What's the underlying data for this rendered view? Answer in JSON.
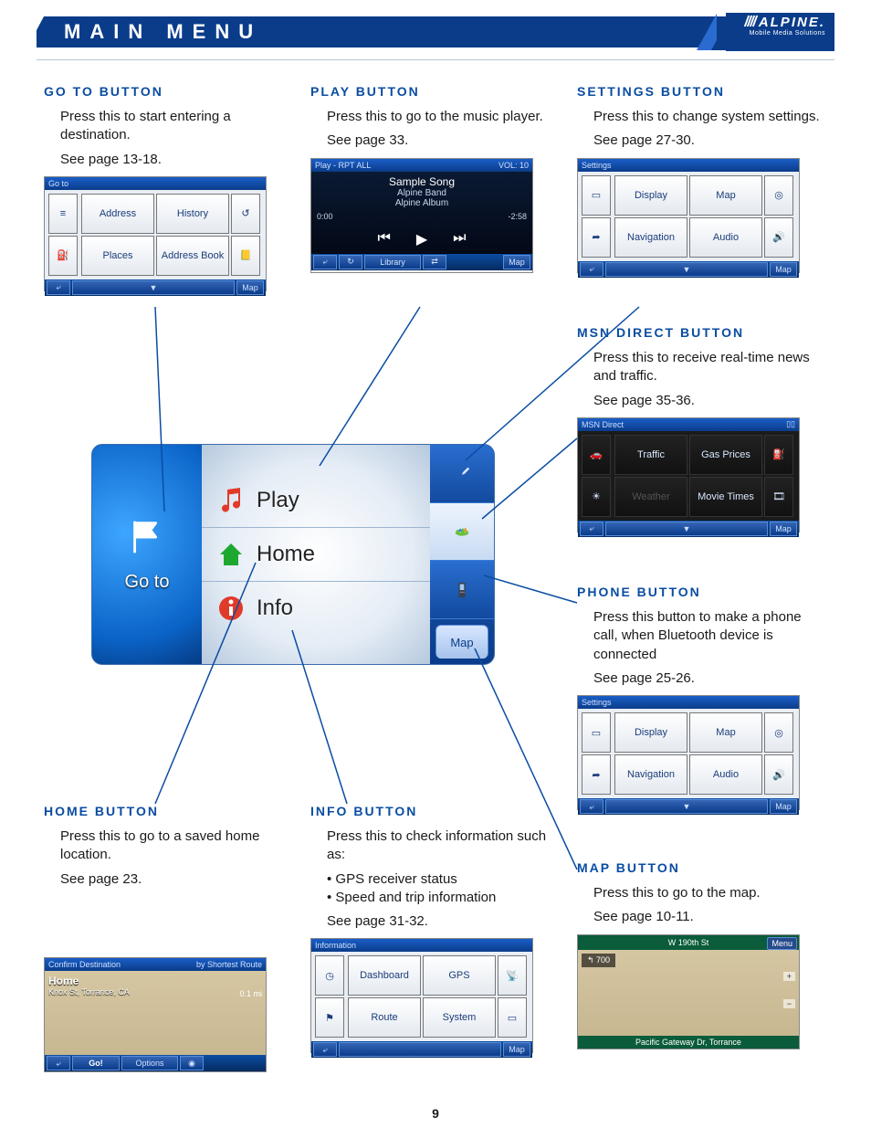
{
  "header": {
    "title": "MAIN MENU",
    "brand": "/ / / / ALPINE",
    "brand_sub": "Mobile Media Solutions"
  },
  "page_number": "9",
  "callouts": {
    "goto": {
      "heading": "GO TO BUTTON",
      "desc": "Press this to start entering a destination.",
      "ref": "See page 13-18."
    },
    "play": {
      "heading": "PLAY BUTTON",
      "desc": "Press this to go to the music player.",
      "ref": "See page 33."
    },
    "settings": {
      "heading": "SETTINGS BUTTON",
      "desc": "Press this to change system settings.",
      "ref": "See page 27-30."
    },
    "msn": {
      "heading": "MSN DIRECT BUTTON",
      "desc": "Press this to receive real-time news and traffic.",
      "ref": "See page 35-36."
    },
    "phone": {
      "heading": "PHONE BUTTON",
      "desc": "Press this button to make a phone call, when Bluetooth device is connected",
      "ref": "See page 25-26."
    },
    "home": {
      "heading": "HOME BUTTON",
      "desc": "Press this to go to a saved home location.",
      "ref": "See page 23."
    },
    "info": {
      "heading": "INFO BUTTON",
      "desc": "Press this to check information such as:",
      "bullets": [
        "GPS receiver status",
        "Speed and trip information"
      ],
      "ref": "See page 31-32."
    },
    "map": {
      "heading": "MAP BUTTON",
      "desc": "Press this to go to the map.",
      "ref": "See page 10-11."
    }
  },
  "mini_screens": {
    "goto": {
      "title": "Go to",
      "cells": [
        "Address",
        "History",
        "Places",
        "Address Book"
      ],
      "map_btn": "Map"
    },
    "play": {
      "title_left": "Play - RPT ALL",
      "title_right": "VOL: 10",
      "song": "Sample Song",
      "artist": "Alpine Band",
      "album": "Alpine Album",
      "t_start": "0:00",
      "t_end": "-2:58",
      "library": "Library",
      "map_btn": "Map"
    },
    "settings": {
      "title": "Settings",
      "cells": [
        "Display",
        "Map",
        "Navigation",
        "Audio"
      ],
      "map_btn": "Map"
    },
    "msn": {
      "title": "MSN Direct",
      "cells": [
        "Traffic",
        "Gas Prices",
        "Weather",
        "Movie Times"
      ],
      "map_btn": "Map"
    },
    "phone": {
      "title": "Settings",
      "cells": [
        "Display",
        "Map",
        "Navigation",
        "Audio"
      ],
      "map_btn": "Map"
    },
    "home": {
      "title_left": "Confirm Destination",
      "title_right": "by Shortest Route",
      "dest": "Home",
      "addr": "Knox St, Torrance, CA",
      "dist": "0.1 mi",
      "go": "Go!",
      "options": "Options"
    },
    "info": {
      "title": "Information",
      "cells": [
        "Dashboard",
        "GPS",
        "Route",
        "System"
      ],
      "map_btn": "Map"
    },
    "map": {
      "street_top": "W 190th St",
      "dist": "700",
      "street_bottom": "Pacific Gateway Dr, Torrance",
      "menu": "Menu"
    }
  },
  "central": {
    "goto": "Go to",
    "play": "Play",
    "home": "Home",
    "info": "Info",
    "map": "Map"
  }
}
